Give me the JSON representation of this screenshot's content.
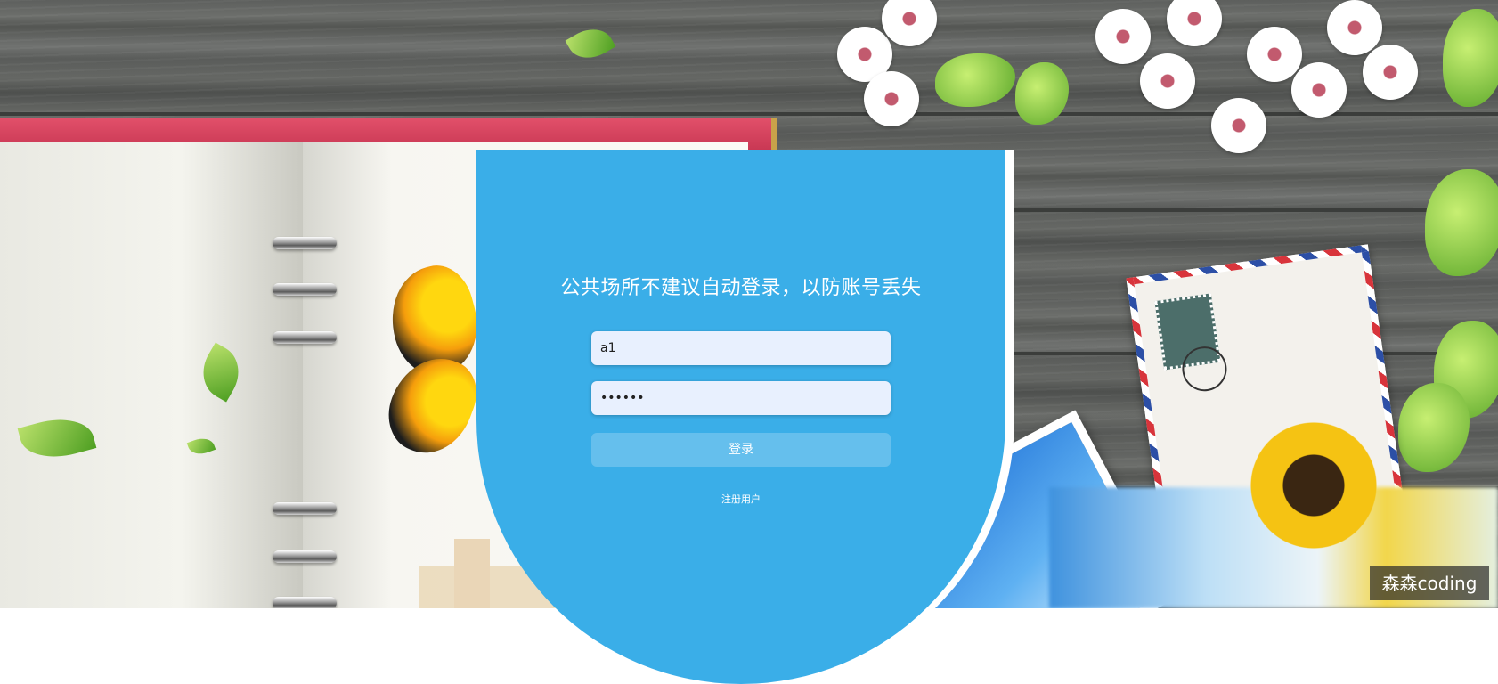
{
  "login": {
    "title": "公共场所不建议自动登录，以防账号丢失",
    "username_value": "a1",
    "password_value": "••••••",
    "login_button_label": "登录",
    "register_link_label": "注册用户"
  },
  "watermark": {
    "text": "森森coding"
  },
  "colors": {
    "panel_bg": "#3aaee8",
    "input_bg": "#e8f0fe"
  }
}
